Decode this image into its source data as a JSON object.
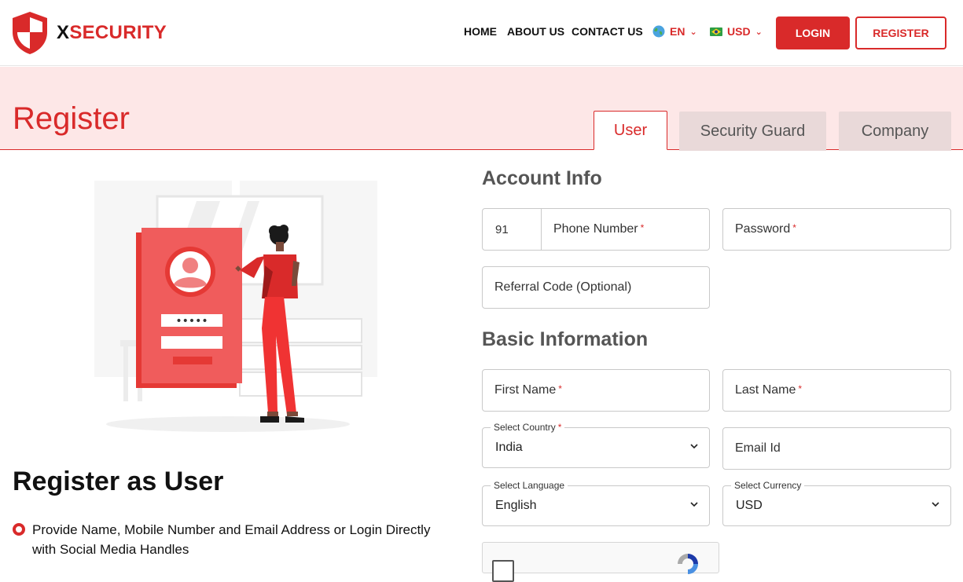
{
  "header": {
    "logo_x": "X",
    "logo_rest": "SECURITY",
    "nav": {
      "home": "HOME",
      "about": "ABOUT US",
      "contact": "CONTACT US"
    },
    "language": "EN",
    "currency": "USD",
    "login_label": "LOGIN",
    "register_label": "REGISTER"
  },
  "banner": {
    "title": "Register",
    "tabs": [
      {
        "label": "User",
        "active": true
      },
      {
        "label": "Security Guard",
        "active": false
      },
      {
        "label": "Company",
        "active": false
      }
    ]
  },
  "left": {
    "heading": "Register as User",
    "bullets": [
      "Provide Name, Mobile Number and Email Address or Login Directly with Social Media Handles"
    ]
  },
  "form": {
    "account_info_title": "Account Info",
    "phone_code": "91",
    "phone_label": "Phone Number",
    "password_label": "Password",
    "referral_label": "Referral Code (Optional)",
    "basic_info_title": "Basic Information",
    "first_name_label": "First Name",
    "last_name_label": "Last Name",
    "country_label": "Select Country",
    "country_value": "India",
    "email_label": "Email Id",
    "language_label": "Select Language",
    "language_value": "English",
    "currency_label": "Select Currency",
    "currency_value": "USD",
    "required_mark": "*"
  },
  "colors": {
    "accent": "#d92a2a",
    "banner_bg": "#fde7e7",
    "tab_inactive_bg": "#e9d9d9"
  }
}
